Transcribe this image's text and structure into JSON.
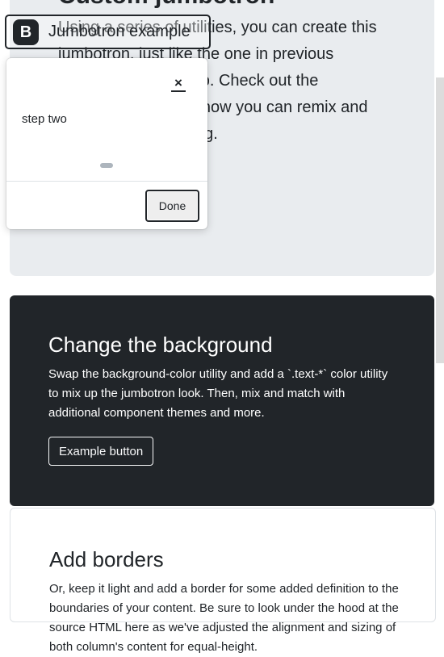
{
  "hero": {
    "title": "Custom jumbotron",
    "lead": "Using a series of utilities, you can create this jumbotron, just like the one in previous versions of Bootstrap. Check out the examples below for how you can remix and restyle it to your liking."
  },
  "brand": {
    "logo_letter": "B",
    "text": "Jumbotron example"
  },
  "popover": {
    "close_label": "×",
    "body": "step two",
    "done_label": "Done"
  },
  "dark_section": {
    "heading": "Change the background",
    "body": "Swap the background-color utility and add a `.text-*` color utility to mix up the jumbotron look. Then, mix and match with additional component themes and more.",
    "button_label": "Example button"
  },
  "border_section": {
    "heading": "Add borders",
    "body": "Or, keep it light and add a border for some added definition to the boundaries of your content. Be sure to look under the hood at the source HTML here as we've adjusted the alignment and sizing of both column's content for equal-height."
  },
  "colors": {
    "dark_bg": "#212529",
    "light_bg": "#e9ecef"
  }
}
